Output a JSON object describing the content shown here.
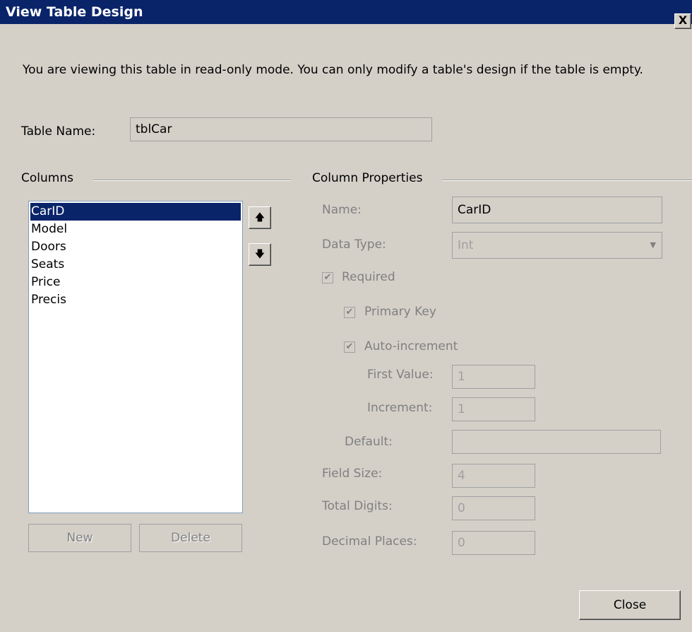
{
  "window": {
    "title": "View Table Design",
    "close_glyph": "X"
  },
  "info_text": "You are viewing this table in read-only mode. You can only modify a table's design if the table is empty.",
  "table_name": {
    "label": "Table Name:",
    "value": "tblCar"
  },
  "columns": {
    "heading": "Columns",
    "items": [
      "CarID",
      "Model",
      "Doors",
      "Seats",
      "Price",
      "Precis"
    ],
    "selected_index": 0,
    "new_label": "New",
    "delete_label": "Delete",
    "up_glyph": "🡅",
    "down_glyph": "🡇"
  },
  "properties": {
    "heading": "Column Properties",
    "name_label": "Name:",
    "name_value": "CarID",
    "data_type_label": "Data Type:",
    "data_type_value": "Int",
    "required_label": "Required",
    "required_checked": true,
    "primary_key_label": "Primary Key",
    "primary_key_checked": true,
    "auto_increment_label": "Auto-increment",
    "auto_increment_checked": true,
    "first_value_label": "First Value:",
    "first_value": "1",
    "increment_label": "Increment:",
    "increment": "1",
    "default_label": "Default:",
    "default_value": "",
    "field_size_label": "Field Size:",
    "field_size": "4",
    "total_digits_label": "Total Digits:",
    "total_digits": "0",
    "decimal_places_label": "Decimal Places:",
    "decimal_places": "0"
  },
  "close_button": "Close"
}
